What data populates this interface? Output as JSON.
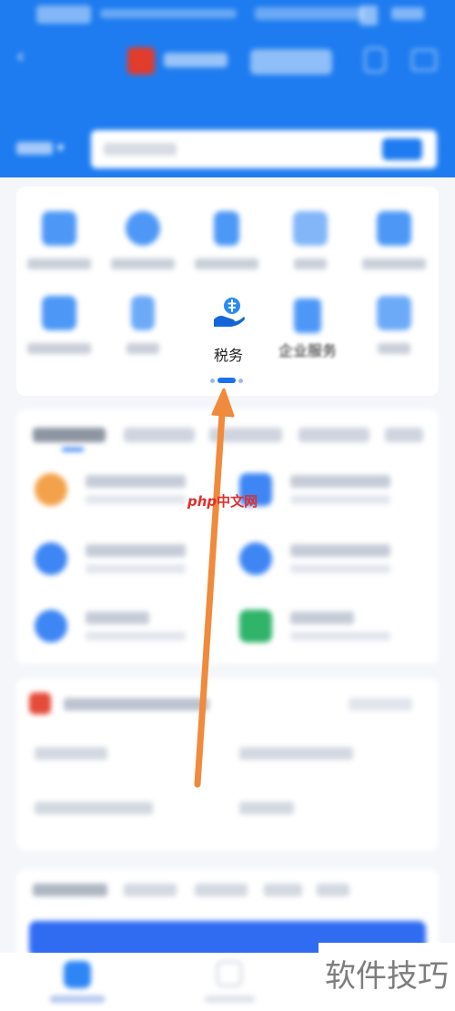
{
  "grid": {
    "items": [
      {
        "label": "税务",
        "icon": "tax-icon"
      },
      {
        "label": "企业服务",
        "icon": "enterprise-icon"
      }
    ]
  },
  "watermark": {
    "top_php": "php",
    "top_cn": "中文网",
    "bottom": "软件技巧"
  },
  "colors": {
    "header_blue": "#1e7cf0",
    "annotation_arrow": "#f08a3c"
  },
  "pager": {
    "total": 3,
    "active": 2
  }
}
